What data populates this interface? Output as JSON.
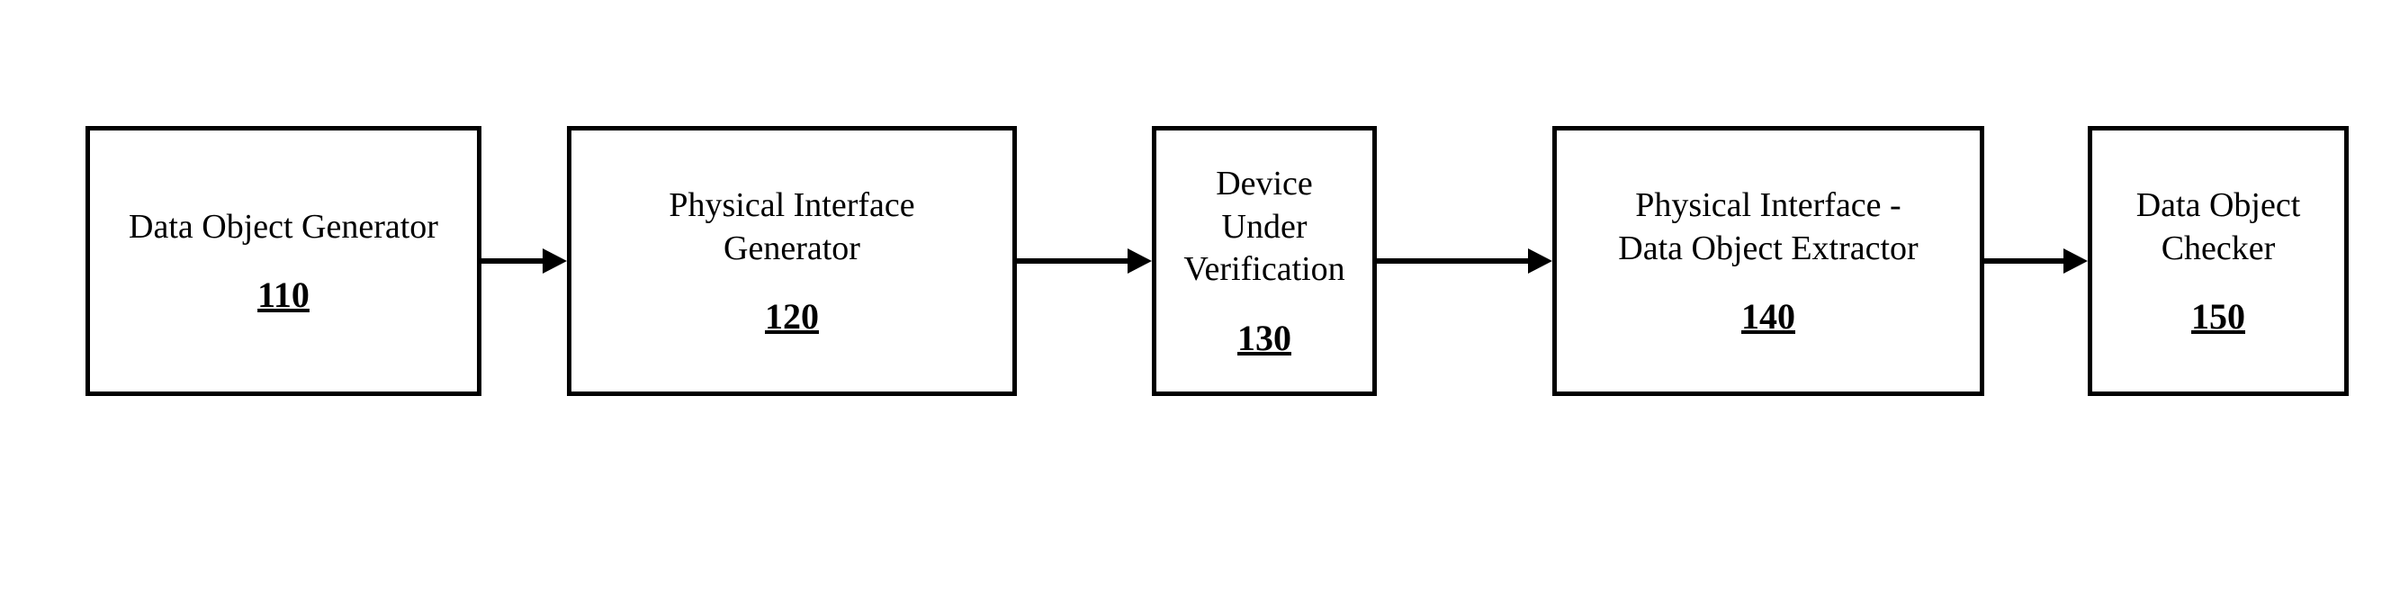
{
  "blocks": {
    "b110": {
      "title": "Data Object Generator",
      "ref": "110"
    },
    "b120": {
      "title": "Physical Interface\nGenerator",
      "ref": "120"
    },
    "b130": {
      "title": "Device\nUnder\nVerification",
      "ref": "130"
    },
    "b140": {
      "title": "Physical Interface -\nData Object Extractor",
      "ref": "140"
    },
    "b150": {
      "title": "Data Object\nChecker",
      "ref": "150"
    }
  }
}
